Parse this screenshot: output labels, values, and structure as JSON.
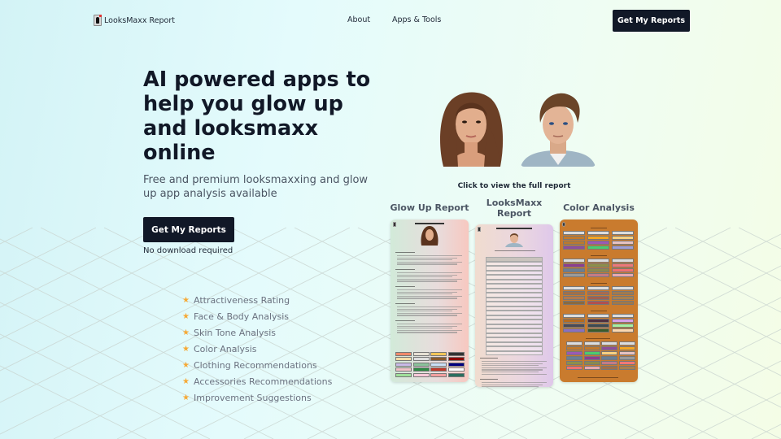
{
  "nav": {
    "logo_text": "LooksMaxx Report",
    "links": [
      "About",
      "Apps & Tools"
    ],
    "cta_label": "Get My Reports"
  },
  "hero": {
    "title": "AI powered apps to help you glow up and looksmaxx online",
    "subtitle": "Free and premium looksmaxxing and glow up app analysis available",
    "cta_label": "Get My Reports",
    "note": "No download required",
    "features": [
      "Attractiveness Rating",
      "Face & Body Analysis",
      "Skin Tone Analysis",
      "Color Analysis",
      "Clothing Recommendations",
      "Accessories Recommendations",
      "Improvement Suggestions"
    ]
  },
  "showcase": {
    "click_label": "Click to view the full report",
    "reports": [
      {
        "title": "Glow Up Report"
      },
      {
        "title": "LooksMaxx Report"
      },
      {
        "title": "Color Analysis"
      }
    ]
  },
  "colors": {
    "primary_dark": "#111827",
    "star": "#f6a935",
    "muted_text": "#6b7280",
    "color_card": "#c97b2e"
  }
}
